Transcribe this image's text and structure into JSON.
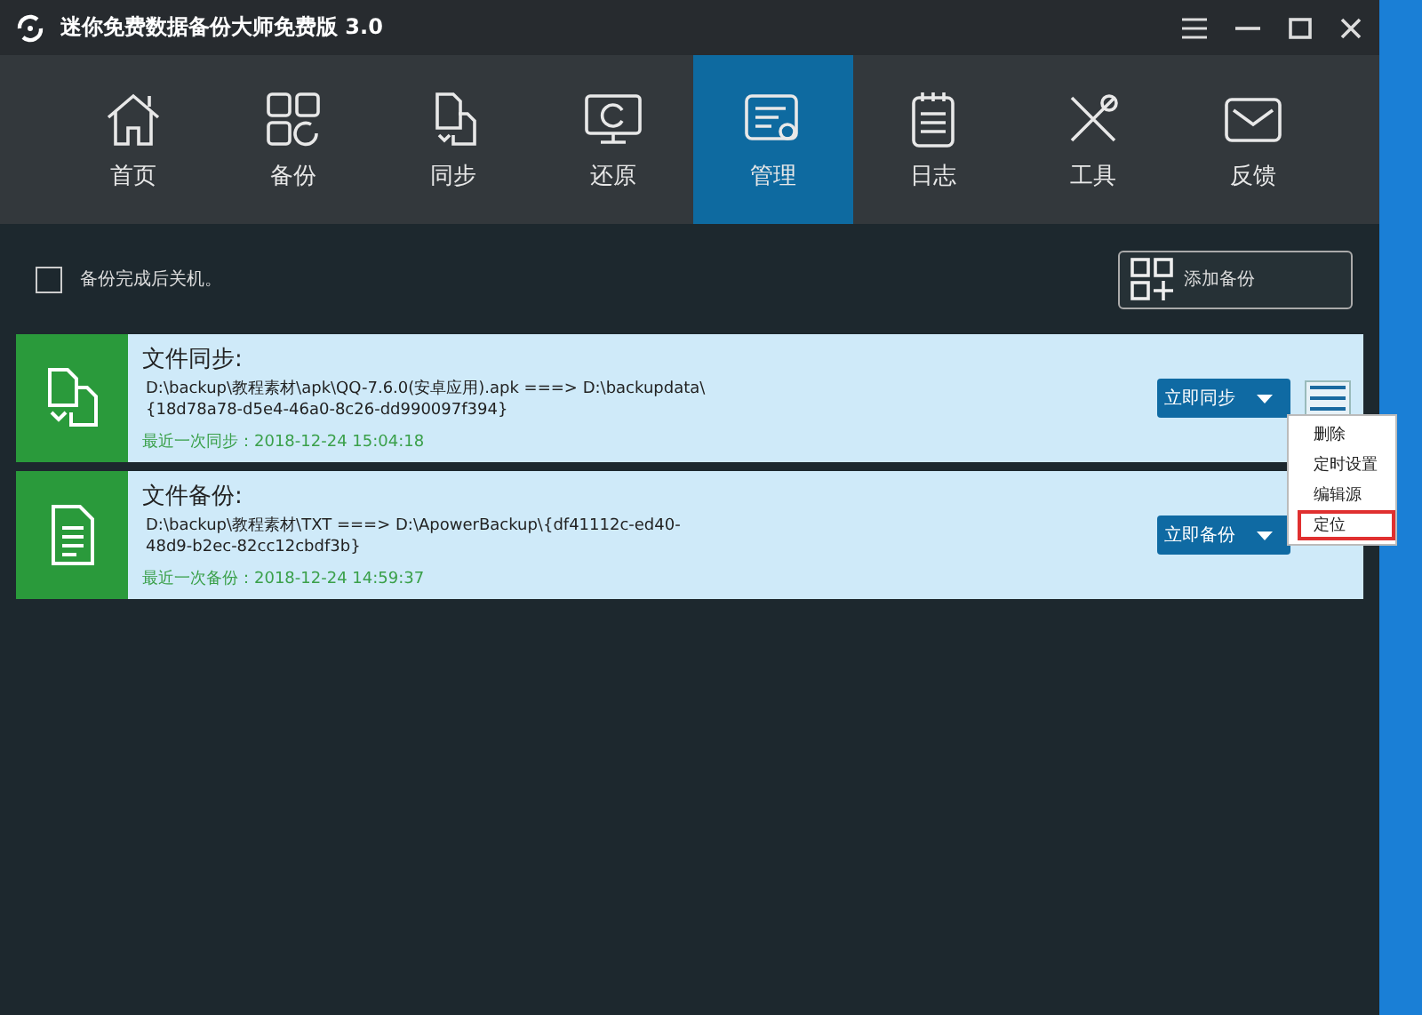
{
  "window": {
    "title": "迷你免费数据备份大师免费版 3.0"
  },
  "nav": [
    {
      "label": "首页",
      "kind": "home",
      "selected": false
    },
    {
      "label": "备份",
      "kind": "grid",
      "selected": false
    },
    {
      "label": "同步",
      "kind": "sync",
      "selected": false
    },
    {
      "label": "还原",
      "kind": "monitor",
      "selected": false
    },
    {
      "label": "管理",
      "kind": "manage",
      "selected": true
    },
    {
      "label": "日志",
      "kind": "notepad",
      "selected": false
    },
    {
      "label": "工具",
      "kind": "tools",
      "selected": false
    },
    {
      "label": "反馈",
      "kind": "mail",
      "selected": false
    }
  ],
  "shutdown_option": {
    "label": "备份完成后关机。",
    "checked": false
  },
  "add_button": {
    "label": "添加备份"
  },
  "tasks": [
    {
      "kind": "sync",
      "title": "文件同步:",
      "path": "D:\\backup\\教程素材\\apk\\QQ-7.6.0(安卓应用).apk ===> D:\\backupdata\\{18d78a78-d5e4-46a0-8c26-dd990097f394}",
      "last_run": "最近一次同步：2018-12-24 15:04:18",
      "action": "立即同步"
    },
    {
      "kind": "backup",
      "title": "文件备份:",
      "path": "D:\\backup\\教程素材\\TXT ===> D:\\ApowerBackup\\{df41112c-ed40-48d9-b2ec-82cc12cbdf3b}",
      "last_run": "最近一次备份：2018-12-24 14:59:37",
      "action": "立即备份"
    }
  ],
  "context_menu": {
    "items": [
      {
        "label": "删除",
        "highlighted": false
      },
      {
        "label": "定时设置",
        "highlighted": false
      },
      {
        "label": "编辑源",
        "highlighted": false
      },
      {
        "label": "定位",
        "highlighted": true
      }
    ]
  }
}
